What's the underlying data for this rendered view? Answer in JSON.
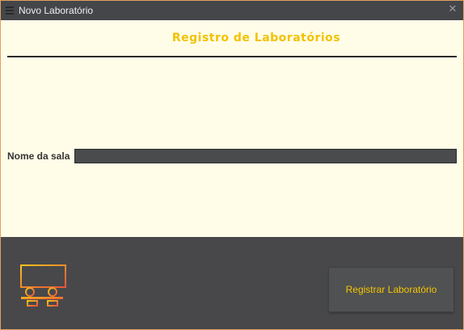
{
  "window": {
    "title": "Novo Laboratório",
    "close_icon": "close-icon"
  },
  "header": {
    "title": "Registro de Laboratórios"
  },
  "form": {
    "room_name_label": "Nome da sala",
    "room_name_value": ""
  },
  "footer": {
    "logo_icon": "classroom-icon",
    "register_label": "Registrar Laboratório"
  },
  "colors": {
    "accent": "#f2c200",
    "panel": "#fffde8",
    "dark": "#48484a"
  }
}
